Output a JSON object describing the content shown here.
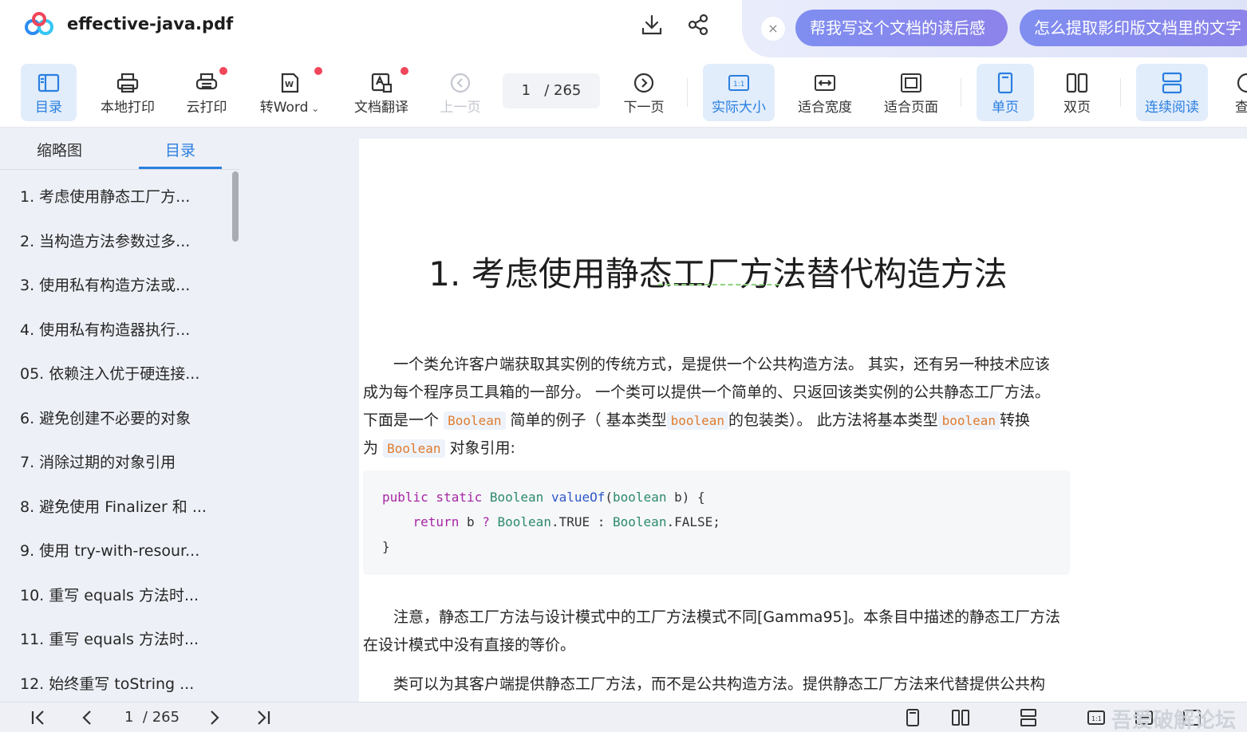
{
  "window": {
    "filename": "effective-java.pdf"
  },
  "ai": {
    "close_icon": "×",
    "suggestions": [
      "帮我写这个文档的读后感",
      "怎么提取影印版文档里的文字"
    ]
  },
  "toolbar": {
    "toc": "目录",
    "local_print": "本地打印",
    "cloud_print": "云打印",
    "to_word": "转Word",
    "translate": "文档翻译",
    "prev_page": "上一页",
    "current_page": "1",
    "total_pages": "/ 265",
    "next_page": "下一页",
    "actual_size": "实际大小",
    "fit_width": "适合宽度",
    "fit_page": "适合页面",
    "single_page": "单页",
    "double_page": "双页",
    "continuous": "连续阅读",
    "more": "查"
  },
  "sidebar": {
    "tabs": [
      "缩略图",
      "目录"
    ],
    "items": [
      "1. 考虑使用静态工厂方...",
      "2. 当构造方法参数过多...",
      "3. 使用私有构造方法或...",
      "4. 使用私有构造器执行...",
      "05. 依赖注入优于硬连接...",
      "6. 避免创建不必要的对象",
      "7. 消除过期的对象引用",
      "8. 避免使用 Finalizer 和 ...",
      "9. 使用 try-with-resour...",
      "10. 重写 equals 方法时...",
      "11. 重写 equals 方法时...",
      "12. 始终重写 toString ..."
    ]
  },
  "document": {
    "title": "1. 考虑使用静态工厂方法替代构造方法",
    "p1": {
      "line1": "一个类允许客户端获取其实例的传统方式，是提供一个公共构造方法。 其实，还有另一种技术应该",
      "line2": "成为每个程序员工具箱的一部分。 一个类可以提供一个简单的、只返回该类实例的公共静态工厂方法。",
      "line3_a": "下面是一个",
      "code1": "Boolean",
      "line3_b": "简单的例子（ 基本类型",
      "code2": "boolean",
      "line3_c": "的包装类）。 此方法将基本类型",
      "code3": "boolean",
      "line3_d": "转换",
      "line4_a": "为",
      "code4": "Boolean",
      "line4_b": "对象引用:"
    },
    "code": {
      "l1_kw": "public static",
      "l1_ty": "Boolean",
      "l1_fn": "valueOf",
      "l1_rest_a": "(",
      "l1_ty2": "boolean",
      "l1_rest_b": " b) {",
      "l2_kw": "return",
      "l2_a": " b ",
      "l2_q": "?",
      "l2_ty": "Boolean",
      "l2_b": ".TRUE : ",
      "l2_ty2": "Boolean",
      "l2_c": ".FALSE;",
      "l3": "}"
    },
    "p2_line1": "注意，静态工厂方法与设计模式中的工厂方法模式不同[Gamma95]。本条目中描述的静态工厂方法",
    "p2_line2": "在设计模式中没有直接的等价。",
    "p3_line1": "类可以为其客户端提供静态工厂方法，而不是公共构造方法。提供静态工厂方法来代替提供公共构"
  },
  "bottom": {
    "current_page": "1",
    "total_pages": "/ 265",
    "watermark": "吾爱破解论坛"
  }
}
